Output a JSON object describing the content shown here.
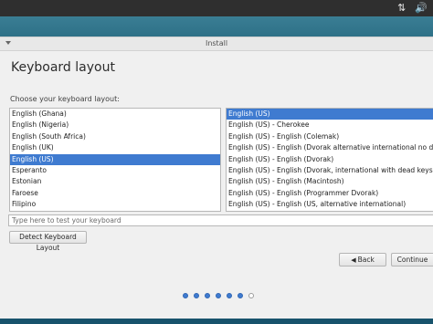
{
  "tray": {
    "network_icon": "⇅",
    "volume_icon": "🔊"
  },
  "window": {
    "title": "Install",
    "page_title": "Keyboard layout",
    "choose_label": "Choose your keyboard layout:"
  },
  "layouts": {
    "items": [
      {
        "label": "English (Ghana)",
        "selected": false
      },
      {
        "label": "English (Nigeria)",
        "selected": false
      },
      {
        "label": "English (South Africa)",
        "selected": false
      },
      {
        "label": "English (UK)",
        "selected": false
      },
      {
        "label": "English (US)",
        "selected": true
      },
      {
        "label": "Esperanto",
        "selected": false
      },
      {
        "label": "Estonian",
        "selected": false
      },
      {
        "label": "Faroese",
        "selected": false
      },
      {
        "label": "Filipino",
        "selected": false
      }
    ]
  },
  "variants": {
    "items": [
      {
        "label": "English (US)",
        "selected": true
      },
      {
        "label": "English (US) - Cherokee",
        "selected": false
      },
      {
        "label": "English (US) - English (Colemak)",
        "selected": false
      },
      {
        "label": "English (US) - English (Dvorak alternative international no dead keys)",
        "selected": false
      },
      {
        "label": "English (US) - English (Dvorak)",
        "selected": false
      },
      {
        "label": "English (US) - English (Dvorak, international with dead keys)",
        "selected": false
      },
      {
        "label": "English (US) - English (Macintosh)",
        "selected": false
      },
      {
        "label": "English (US) - English (Programmer Dvorak)",
        "selected": false
      },
      {
        "label": "English (US) - English (US, alternative international)",
        "selected": false
      }
    ]
  },
  "test_field": {
    "placeholder": "Type here to test your keyboard",
    "value": ""
  },
  "buttons": {
    "detect": "Detect Keyboard Layout",
    "back": "Back",
    "back_icon": "◀",
    "continue": "Continue"
  },
  "progress": {
    "total_steps": 7,
    "completed_steps": 6
  },
  "colors": {
    "accent": "#3f7bd0",
    "desktop": "#1d5a73",
    "topbar": "#2f2f2f"
  }
}
